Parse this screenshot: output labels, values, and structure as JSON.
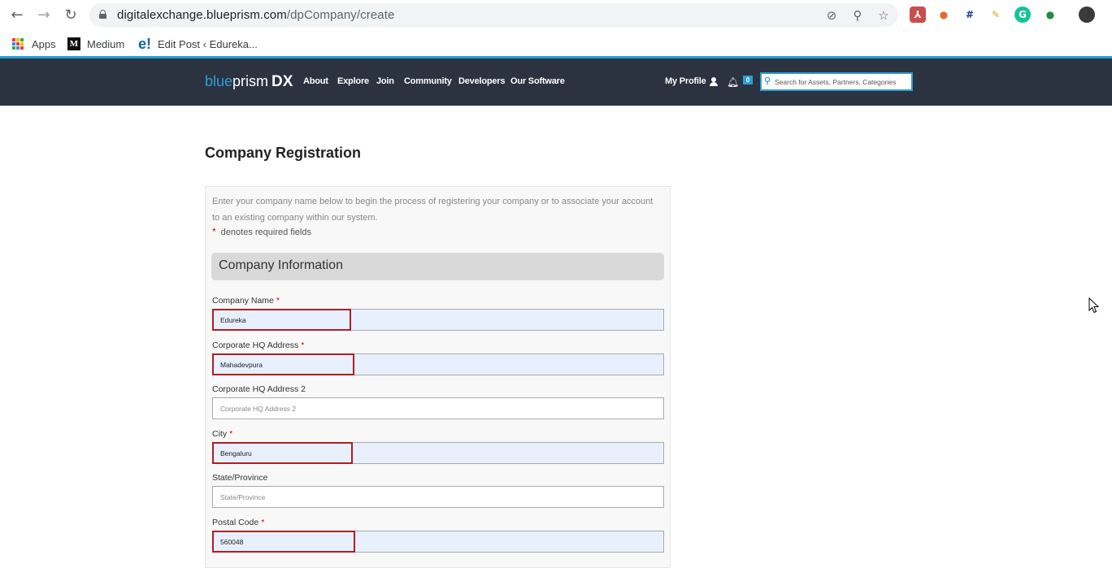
{
  "browser": {
    "url_host": "digitalexchange.blueprism.com",
    "url_path": "/dpCompany/create",
    "bookmarks": [
      {
        "label": "Apps"
      },
      {
        "label": "Medium"
      },
      {
        "label": "Edit Post ‹ Edureka..."
      }
    ]
  },
  "site": {
    "brand_blue": "blue",
    "brand_prism": "prism",
    "brand_dx": "DX",
    "nav": [
      "About",
      "Explore",
      "Join",
      "Community",
      "Developers",
      "Our Software"
    ],
    "profile_label": "My Profile",
    "notification_count": "0",
    "search_placeholder": "Search for Assets, Partners, Categories"
  },
  "page": {
    "title": "Company Registration",
    "intro": "Enter your company name below to begin the process of registering your company or to associate your account to an existing company within our system.",
    "required_note": "denotes required fields",
    "section_title": "Company Information",
    "fields": [
      {
        "label": "Company Name",
        "required": "*",
        "value": "Edureka",
        "placeholder": ""
      },
      {
        "label": "Corporate HQ Address",
        "required": "*",
        "value": "Mahadevpura",
        "placeholder": ""
      },
      {
        "label": "Corporate HQ Address 2",
        "required": "",
        "value": "",
        "placeholder": "Corporate HQ Address 2"
      },
      {
        "label": "City",
        "required": "*",
        "value": "Bengaluru",
        "placeholder": ""
      },
      {
        "label": "State/Province",
        "required": "",
        "value": "",
        "placeholder": "State/Province"
      },
      {
        "label": "Postal Code",
        "required": "*",
        "value": "560048",
        "placeholder": ""
      }
    ]
  },
  "colors": {
    "header_bg": "#2b3240",
    "accent": "#2a9fd6",
    "highlight": "#b01e23",
    "autofill": "#e8f0fe"
  }
}
